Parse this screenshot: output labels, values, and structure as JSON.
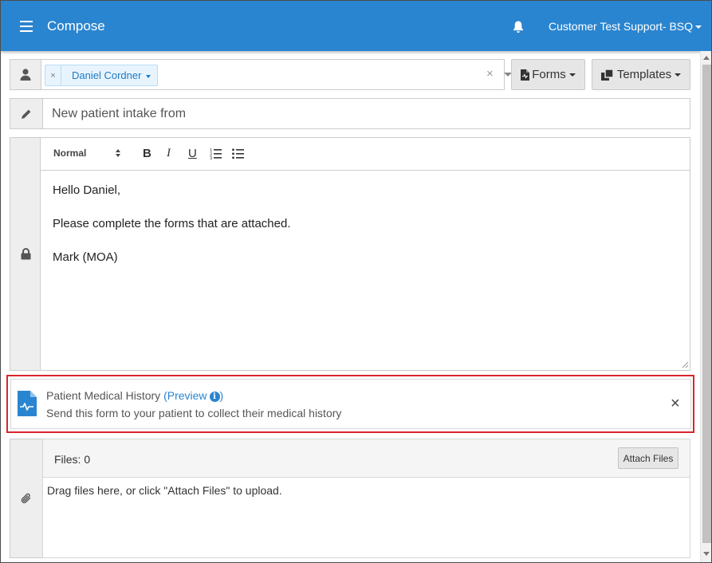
{
  "navbar": {
    "title": "Compose",
    "user": "Customer Test Support- BSQ",
    "color": "#2a85d0"
  },
  "recipients": {
    "tags": [
      {
        "label": "Daniel Cordner"
      }
    ],
    "clear_symbol": "×",
    "remove_symbol": "×"
  },
  "buttons": {
    "forms": "Forms",
    "templates": "Templates"
  },
  "subject": {
    "value": "New patient intake from"
  },
  "editor": {
    "style_select": "Normal",
    "bold": "B",
    "italic": "I",
    "underline": "U",
    "body": [
      "Hello Daniel,",
      "Please complete the forms that are attached.",
      "Mark (MOA)"
    ]
  },
  "attachment": {
    "title": "Patient Medical History",
    "open_paren": "(",
    "preview": "Preview",
    "close_paren": ")",
    "info": "i",
    "description": "Send this form to your patient to collect their medical history",
    "close_symbol": "×",
    "highlight_color": "#d9262b"
  },
  "files": {
    "count_label": "Files: 0",
    "attach_button": "Attach Files",
    "drop_text": "Drag files here, or click \"Attach Files\" to upload."
  }
}
